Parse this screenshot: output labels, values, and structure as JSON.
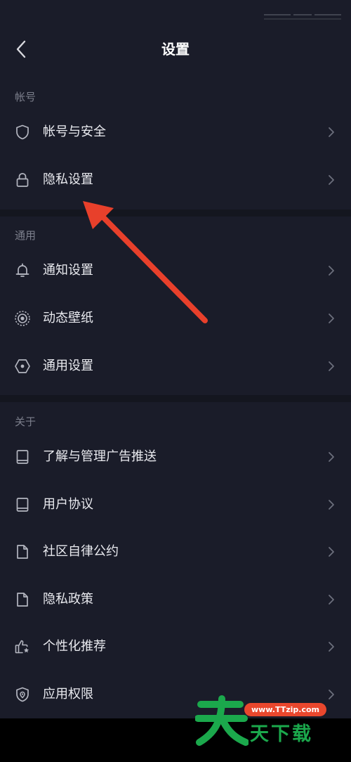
{
  "header": {
    "title": "设置"
  },
  "sections": [
    {
      "header": "帐号",
      "items": [
        {
          "label": "帐号与安全",
          "icon": "shield-icon"
        },
        {
          "label": "隐私设置",
          "icon": "lock-icon"
        }
      ]
    },
    {
      "header": "通用",
      "items": [
        {
          "label": "通知设置",
          "icon": "bell-icon"
        },
        {
          "label": "动态壁纸",
          "icon": "live-wallpaper-icon"
        },
        {
          "label": "通用设置",
          "icon": "hexagon-settings-icon"
        }
      ]
    },
    {
      "header": "关于",
      "items": [
        {
          "label": "了解与管理广告推送",
          "icon": "book-icon"
        },
        {
          "label": "用户协议",
          "icon": "book-icon"
        },
        {
          "label": "社区自律公约",
          "icon": "document-icon"
        },
        {
          "label": "隐私政策",
          "icon": "document-icon"
        },
        {
          "label": "个性化推荐",
          "icon": "thumbs-up-icon"
        },
        {
          "label": "应用权限",
          "icon": "shield-location-icon"
        }
      ]
    }
  ],
  "watermark": {
    "url": "www.TTzip.com",
    "glyph": "天",
    "text": "天下载"
  },
  "colors": {
    "background": "#1a1c29",
    "text": "#e9eaef",
    "section_header": "#7c7f8c",
    "icon": "#b4b6c0",
    "chevron": "#6c6f7c",
    "annotation_arrow": "#e8402b",
    "watermark_green": "#1ba84c",
    "watermark_red": "#e9472d"
  }
}
